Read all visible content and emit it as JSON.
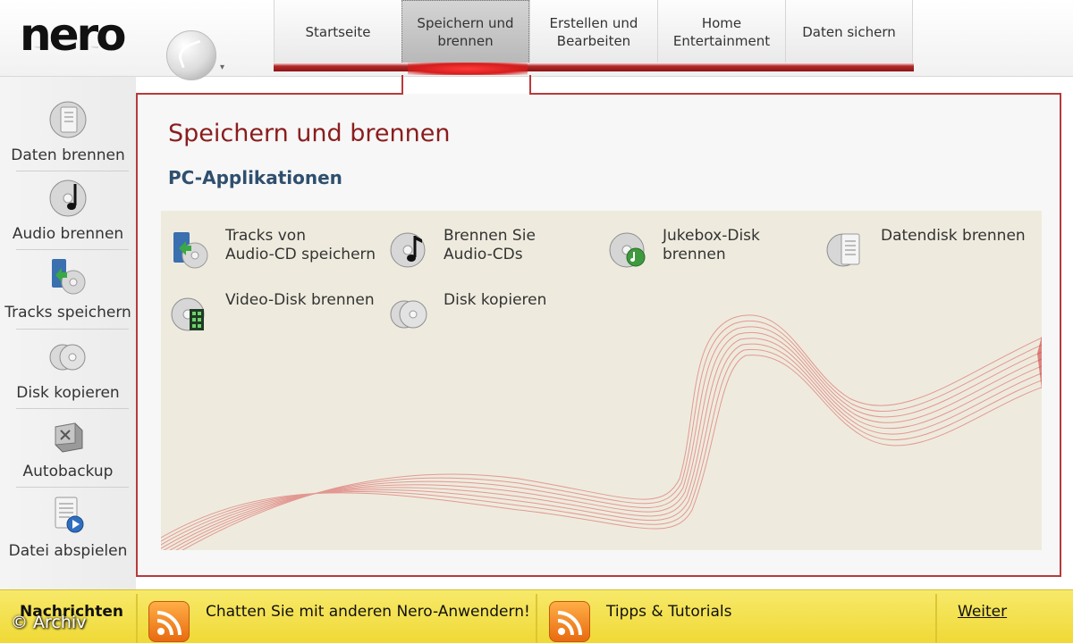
{
  "app": {
    "logo": "nero"
  },
  "nav": {
    "tabs": [
      {
        "label": "Startseite",
        "active": false
      },
      {
        "label": "Speichern und\nbrennen",
        "active": true
      },
      {
        "label": "Erstellen und\nBearbeiten",
        "active": false
      },
      {
        "label": "Home\nEntertainment",
        "active": false
      },
      {
        "label": "Daten sichern",
        "active": false
      }
    ]
  },
  "sidebar": {
    "items": [
      {
        "label": "Daten brennen",
        "icon": "data-disc-icon"
      },
      {
        "label": "Audio brennen",
        "icon": "audio-disc-icon"
      },
      {
        "label": "Tracks speichern",
        "icon": "tracks-save-icon"
      },
      {
        "label": "Disk kopieren",
        "icon": "disc-copy-icon"
      },
      {
        "label": "Autobackup",
        "icon": "autobackup-icon"
      },
      {
        "label": "Datei abspielen",
        "icon": "play-file-icon"
      }
    ]
  },
  "main": {
    "title": "Speichern und brennen",
    "subtitle": "PC-Applikationen",
    "apps": [
      {
        "label": "Tracks von\nAudio-CD speichern",
        "icon": "tracks-save-icon"
      },
      {
        "label": "Brennen Sie\nAudio-CDs",
        "icon": "audio-disc-icon"
      },
      {
        "label": "Jukebox-Disk\nbrennen",
        "icon": "jukebox-disc-icon"
      },
      {
        "label": "Datendisk brennen",
        "icon": "data-disc-icon"
      },
      {
        "label": "Video-Disk brennen",
        "icon": "video-disc-icon"
      },
      {
        "label": "Disk kopieren",
        "icon": "disc-copy-icon"
      }
    ]
  },
  "bottom": {
    "news_label": "Nachrichten",
    "chat_text": "Chatten Sie mit anderen Nero-Anwendern!",
    "tips_text": "Tipps & Tutorials",
    "more_link": "Weiter"
  },
  "watermark": "© Archiv",
  "colors": {
    "accent_red": "#b83a3a",
    "title_red": "#8a1d1d",
    "subtitle_blue": "#2f4f6e",
    "bottom_yellow": "#f0d936",
    "apps_bg": "#eeebde"
  }
}
